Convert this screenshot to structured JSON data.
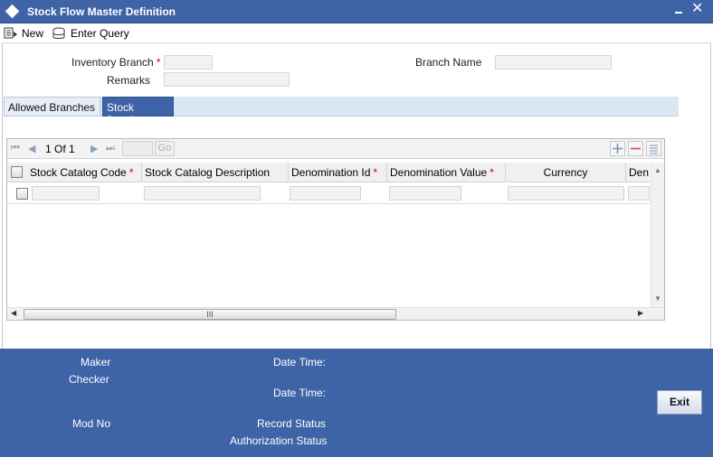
{
  "window": {
    "title": "Stock Flow Master Definition"
  },
  "toolbar": {
    "new_label": "New",
    "enter_query_label": "Enter Query"
  },
  "form": {
    "inventory_branch_label": "Inventory Branch",
    "required_marker": "*",
    "inventory_branch_value": "",
    "branch_name_label": "Branch Name",
    "branch_name_value": "",
    "remarks_label": "Remarks",
    "remarks_value": ""
  },
  "tabs": [
    {
      "label": "Allowed Branches",
      "active": false
    },
    {
      "label": "Stock Details",
      "active": true
    }
  ],
  "grid": {
    "page_text": "1 Of 1",
    "page_input": "",
    "go_label": "Go",
    "columns": [
      {
        "label": "Stock Catalog Code",
        "required": true
      },
      {
        "label": "Stock Catalog Description",
        "required": false
      },
      {
        "label": "Denomination Id",
        "required": true
      },
      {
        "label": "Denomination Value",
        "required": true
      },
      {
        "label": "Currency",
        "required": false
      },
      {
        "label": "Den",
        "required": false
      }
    ],
    "rows": [
      {
        "stock_catalog_code": "",
        "stock_catalog_description": "",
        "denomination_id": "",
        "denomination_value": "",
        "currency": "",
        "den": ""
      }
    ],
    "hscroll_grip": "III"
  },
  "footer": {
    "maker_label": "Maker",
    "checker_label": "Checker",
    "date_time_label_1": "Date Time:",
    "date_time_label_2": "Date Time:",
    "mod_no_label": "Mod No",
    "record_status_label": "Record Status",
    "authorization_status_label": "Authorization Status",
    "exit_label": "Exit"
  },
  "colors": {
    "title_bar": "#3e63a6",
    "required": "#cc0000",
    "tab_strip": "#dbe6f4",
    "footer": "#3e63a6"
  }
}
